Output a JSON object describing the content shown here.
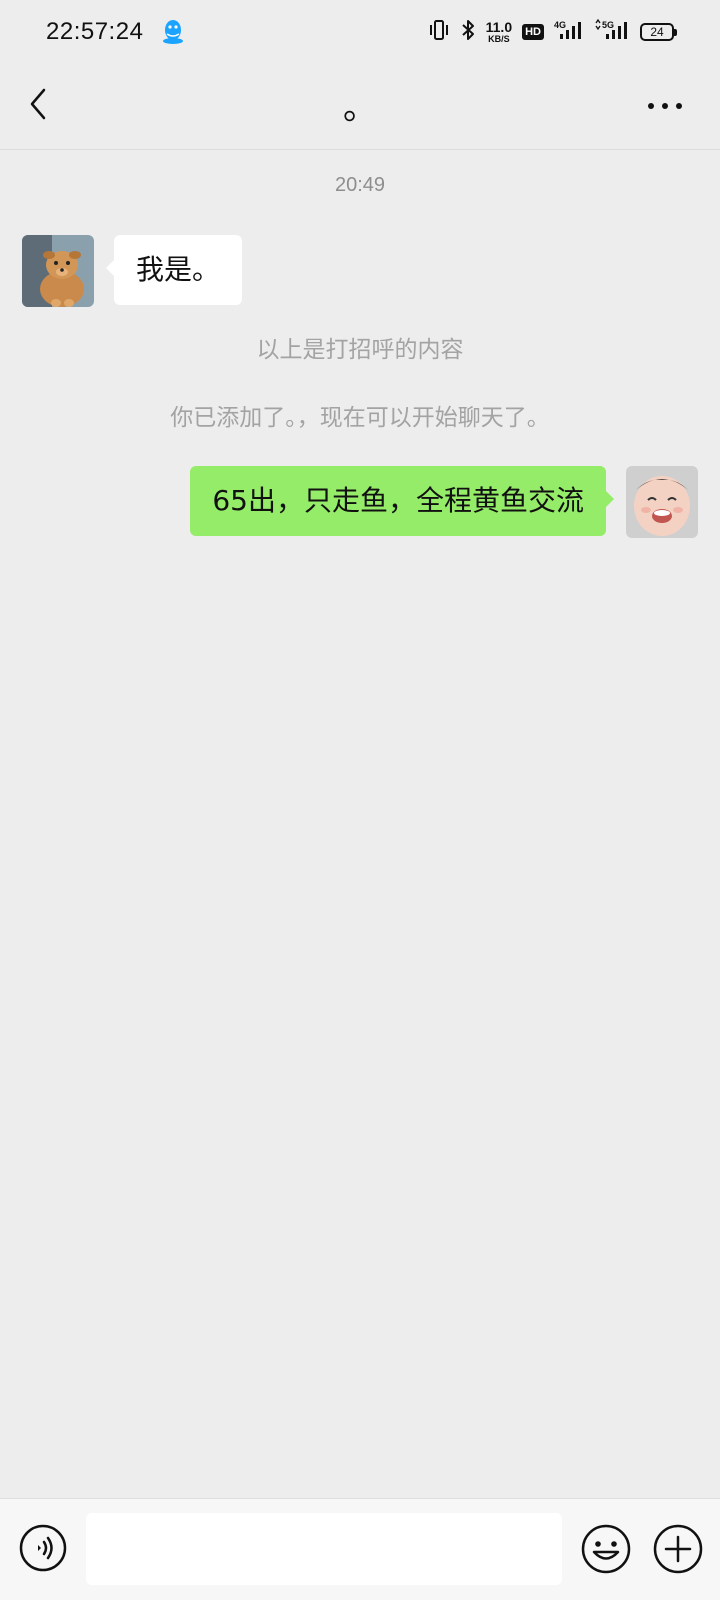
{
  "status_bar": {
    "time": "22:57:24",
    "net_speed_value": "11.0",
    "net_speed_unit": "KB/S",
    "hd_label": "HD",
    "signal_1_label": "4G",
    "signal_2_label": "5G",
    "battery_level": "24"
  },
  "nav": {
    "title": "。",
    "back_icon": "chevron-left-icon",
    "more_icon": "more-dots-icon"
  },
  "chat": {
    "timestamp": "20:49",
    "incoming_message": "我是。",
    "system_notes": [
      "以上是打招呼的内容",
      "你已添加了。，现在可以开始聊天了。"
    ],
    "outgoing_message": "65出，只走鱼，全程黄鱼交流"
  },
  "input_bar": {
    "input_value": "",
    "voice_icon": "voice-icon",
    "emoji_icon": "emoji-icon",
    "plus_icon": "plus-icon"
  },
  "colors": {
    "background": "#ededed",
    "outgoing_bubble": "#95ec69",
    "incoming_bubble": "#ffffff",
    "system_text": "#a3a3a3"
  }
}
